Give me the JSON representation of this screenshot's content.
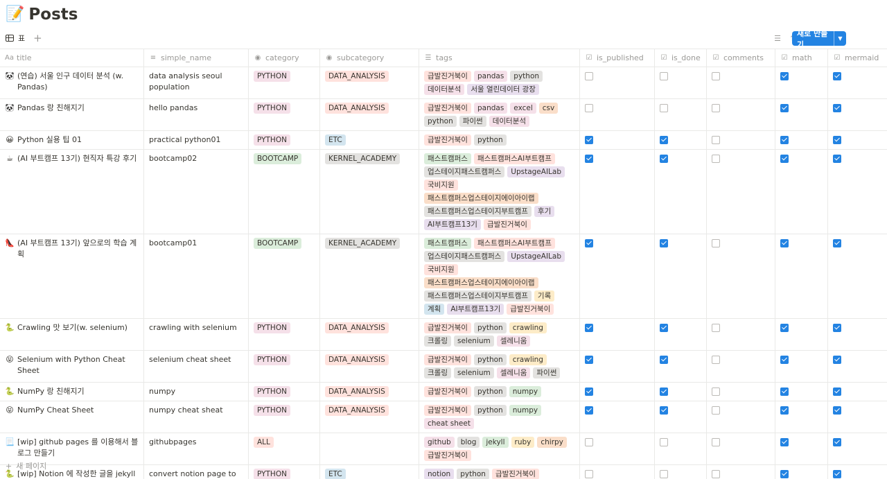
{
  "page": {
    "emoji": "📝",
    "title": "Posts"
  },
  "view": {
    "name": "표",
    "add_symbol": "+"
  },
  "toolbar": {
    "new_label": "새로 만들기"
  },
  "colors": {
    "accent": "#2383e2",
    "tag_pink": "#f5e0e9",
    "tag_red": "#ffe2dd",
    "tag_gray": "#e3e2e0",
    "tag_blue": "#d3e5ef",
    "tag_green": "#dbeddb",
    "tag_orange": "#fadec9",
    "tag_purple": "#e8deee",
    "tag_yellow": "#fdecc8"
  },
  "columns": [
    {
      "icon": "Aa",
      "label": "title"
    },
    {
      "icon": "≡",
      "label": "simple_name"
    },
    {
      "icon": "◉",
      "label": "category"
    },
    {
      "icon": "◉",
      "label": "subcategory"
    },
    {
      "icon": "☰",
      "label": "tags"
    },
    {
      "icon": "☑",
      "label": "is_published"
    },
    {
      "icon": "☑",
      "label": "is_done"
    },
    {
      "icon": "☑",
      "label": "comments"
    },
    {
      "icon": "☑",
      "label": "math"
    },
    {
      "icon": "☑",
      "label": "mermaid"
    }
  ],
  "rows": [
    {
      "emoji": "🐼",
      "title": "(연습) 서울 인구 데이터 분석 (w. Pandas)",
      "simple_name": "data analysis seoul population",
      "category": {
        "label": "PYTHON",
        "color": "pink"
      },
      "subcategory": {
        "label": "DATA_ANALYSIS",
        "color": "red"
      },
      "tags": [
        {
          "label": "급발진거북이",
          "color": "red"
        },
        {
          "label": "pandas",
          "color": "pink"
        },
        {
          "label": "python",
          "color": "gray"
        },
        {
          "label": "데이터분석",
          "color": "pink"
        },
        {
          "label": "서울 열린데이터 광장",
          "color": "purple"
        }
      ],
      "checks": [
        false,
        false,
        false,
        true,
        true
      ]
    },
    {
      "emoji": "🐼",
      "title": "Pandas 랑 친해지기",
      "simple_name": "hello pandas",
      "category": {
        "label": "PYTHON",
        "color": "pink"
      },
      "subcategory": {
        "label": "DATA_ANALYSIS",
        "color": "red"
      },
      "tags": [
        {
          "label": "급발진거북이",
          "color": "red"
        },
        {
          "label": "pandas",
          "color": "pink"
        },
        {
          "label": "excel",
          "color": "pink"
        },
        {
          "label": "csv",
          "color": "orange"
        },
        {
          "label": "python",
          "color": "gray"
        },
        {
          "label": "파이썬",
          "color": "gray"
        },
        {
          "label": "데이터분석",
          "color": "pink"
        }
      ],
      "checks": [
        false,
        false,
        false,
        true,
        true
      ]
    },
    {
      "emoji": "😀",
      "title": "Python 실용 팁 01",
      "simple_name": "practical python01",
      "category": {
        "label": "PYTHON",
        "color": "pink"
      },
      "subcategory": {
        "label": "ETC",
        "color": "blue"
      },
      "tags": [
        {
          "label": "급발진거북이",
          "color": "red"
        },
        {
          "label": "python",
          "color": "gray"
        }
      ],
      "checks": [
        true,
        true,
        false,
        true,
        true
      ]
    },
    {
      "emoji": "☕",
      "title": "(AI 부트캠프 13기) 현직자 특강 후기",
      "simple_name": "bootcamp02",
      "category": {
        "label": "BOOTCAMP",
        "color": "green"
      },
      "subcategory": {
        "label": "KERNEL_ACADEMY",
        "color": "gray"
      },
      "tags": [
        {
          "label": "패스트캠퍼스",
          "color": "green"
        },
        {
          "label": "패스트캠퍼스AI부트캠프",
          "color": "red"
        },
        {
          "label": "업스테이지패스트캠퍼스",
          "color": "gray"
        },
        {
          "label": "UpstageAILab",
          "color": "purple"
        },
        {
          "label": "국비지원",
          "color": "red"
        },
        {
          "label": "패스트캠퍼스업스테이지에이아이랩",
          "color": "orange"
        },
        {
          "label": "패스트캠퍼스업스테이지부트캠프",
          "color": "gray"
        },
        {
          "label": "후기",
          "color": "purple"
        },
        {
          "label": "AI부트캠프13기",
          "color": "purple"
        },
        {
          "label": "급발진거북이",
          "color": "red"
        }
      ],
      "checks": [
        true,
        true,
        false,
        true,
        true
      ]
    },
    {
      "emoji": "👠",
      "title": "(AI 부트캠프 13기) 앞으로의 학습 계획",
      "simple_name": "bootcamp01",
      "category": {
        "label": "BOOTCAMP",
        "color": "green"
      },
      "subcategory": {
        "label": "KERNEL_ACADEMY",
        "color": "gray"
      },
      "tags": [
        {
          "label": "패스트캠퍼스",
          "color": "green"
        },
        {
          "label": "패스트캠퍼스AI부트캠프",
          "color": "red"
        },
        {
          "label": "업스테이지패스트캠퍼스",
          "color": "gray"
        },
        {
          "label": "UpstageAILab",
          "color": "purple"
        },
        {
          "label": "국비지원",
          "color": "red"
        },
        {
          "label": "패스트캠퍼스업스테이지에이아이랩",
          "color": "orange"
        },
        {
          "label": "패스트캠퍼스업스테이지부트캠프",
          "color": "gray"
        },
        {
          "label": "기록",
          "color": "yellow"
        },
        {
          "label": "계획",
          "color": "blue"
        },
        {
          "label": "AI부트캠프13기",
          "color": "purple"
        },
        {
          "label": "급발진거북이",
          "color": "red"
        }
      ],
      "checks": [
        true,
        true,
        false,
        true,
        true
      ]
    },
    {
      "emoji": "🐍",
      "title": "Crawling 맛 보기(w. selenium)",
      "simple_name": "crawling with selenium",
      "category": {
        "label": "PYTHON",
        "color": "pink"
      },
      "subcategory": {
        "label": "DATA_ANALYSIS",
        "color": "red"
      },
      "tags": [
        {
          "label": "급발진거북이",
          "color": "red"
        },
        {
          "label": "python",
          "color": "gray"
        },
        {
          "label": "crawling",
          "color": "yellow"
        },
        {
          "label": "크롤링",
          "color": "gray"
        },
        {
          "label": "selenium",
          "color": "gray"
        },
        {
          "label": "셀레니움",
          "color": "pink"
        }
      ],
      "checks": [
        true,
        true,
        false,
        true,
        true
      ]
    },
    {
      "emoji": "😝",
      "title": "Selenium with Python Cheat Sheet",
      "simple_name": "selenium cheat sheet",
      "category": {
        "label": "PYTHON",
        "color": "pink"
      },
      "subcategory": {
        "label": "DATA_ANALYSIS",
        "color": "red"
      },
      "tags": [
        {
          "label": "급발진거북이",
          "color": "red"
        },
        {
          "label": "python",
          "color": "gray"
        },
        {
          "label": "crawling",
          "color": "yellow"
        },
        {
          "label": "크롤링",
          "color": "gray"
        },
        {
          "label": "selenium",
          "color": "gray"
        },
        {
          "label": "셀레니움",
          "color": "pink"
        },
        {
          "label": "파이썬",
          "color": "gray"
        }
      ],
      "checks": [
        true,
        true,
        false,
        true,
        true
      ]
    },
    {
      "emoji": "🐍",
      "title": "NumPy 랑 친해지기",
      "simple_name": "numpy",
      "category": {
        "label": "PYTHON",
        "color": "pink"
      },
      "subcategory": {
        "label": "DATA_ANALYSIS",
        "color": "red"
      },
      "tags": [
        {
          "label": "급발진거북이",
          "color": "red"
        },
        {
          "label": "python",
          "color": "gray"
        },
        {
          "label": "numpy",
          "color": "green"
        }
      ],
      "checks": [
        true,
        true,
        false,
        true,
        true
      ]
    },
    {
      "emoji": "😝",
      "title": "NumPy Cheat Sheet",
      "simple_name": "numpy cheat sheat",
      "category": {
        "label": "PYTHON",
        "color": "pink"
      },
      "subcategory": {
        "label": "DATA_ANALYSIS",
        "color": "red"
      },
      "tags": [
        {
          "label": "급발진거북이",
          "color": "red"
        },
        {
          "label": "python",
          "color": "gray"
        },
        {
          "label": "numpy",
          "color": "green"
        },
        {
          "label": "cheat sheet",
          "color": "pink"
        }
      ],
      "checks": [
        true,
        true,
        false,
        true,
        true
      ]
    },
    {
      "emoji": "📃",
      "title": "[wip] github pages 를 이용해서 블로그 만들기",
      "simple_name": "githubpages",
      "category": {
        "label": "ALL",
        "color": "red"
      },
      "subcategory": null,
      "tags": [
        {
          "label": "github",
          "color": "pink"
        },
        {
          "label": "blog",
          "color": "gray"
        },
        {
          "label": "jekyll",
          "color": "green"
        },
        {
          "label": "ruby",
          "color": "yellow"
        },
        {
          "label": "chirpy",
          "color": "orange"
        },
        {
          "label": "급발진거북이",
          "color": "red"
        }
      ],
      "checks": [
        false,
        false,
        false,
        true,
        true
      ]
    },
    {
      "emoji": "🐍",
      "title": "[wip] Notion 에 작성한 글을 jekyll 용 post 로 만들기 (w. python)",
      "simple_name": "convert notion page to jekyll post",
      "category": {
        "label": "PYTHON",
        "color": "pink"
      },
      "subcategory": {
        "label": "ETC",
        "color": "blue"
      },
      "tags": [
        {
          "label": "notion",
          "color": "purple"
        },
        {
          "label": "python",
          "color": "gray"
        },
        {
          "label": "급발진거북이",
          "color": "red"
        }
      ],
      "checks": [
        false,
        false,
        false,
        true,
        true
      ]
    }
  ],
  "footer": {
    "add_symbol": "+",
    "new_page_label": "새 페이지"
  }
}
